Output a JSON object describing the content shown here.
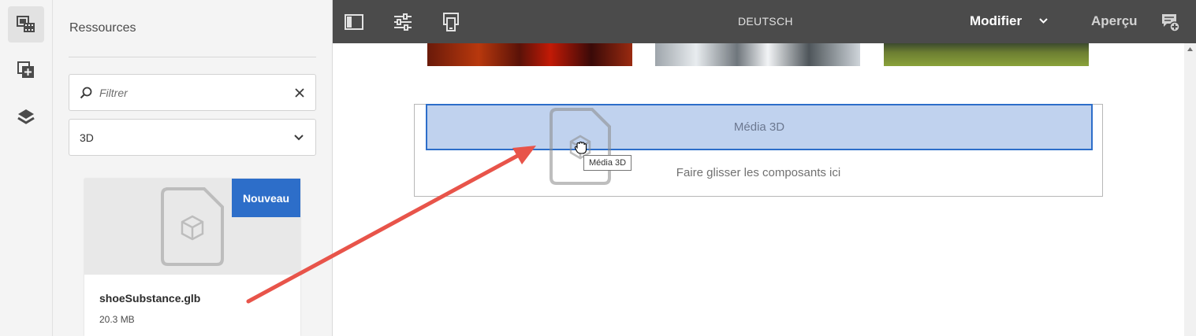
{
  "rail": {
    "items": [
      {
        "name": "assets",
        "icon": "assets-icon",
        "active": true
      },
      {
        "name": "components",
        "icon": "add-component-icon",
        "active": false
      },
      {
        "name": "content-tree",
        "icon": "layers-icon",
        "active": false
      }
    ]
  },
  "panel": {
    "title": "Ressources",
    "search": {
      "placeholder": "Filtrer",
      "value": ""
    },
    "filter": {
      "selected": "3D"
    },
    "asset": {
      "badge": "Nouveau",
      "name": "shoeSubstance.glb",
      "size": "20.3 MB",
      "icon": "3d-file-icon"
    }
  },
  "toolbar": {
    "language": "DEUTSCH",
    "mode": "Modifier",
    "preview": "Aperçu",
    "icons": [
      "toggle-side-panel-icon",
      "page-properties-icon",
      "emulator-icon",
      "annotations-icon"
    ]
  },
  "canvas": {
    "dropzone": {
      "highlight_label": "Média 3D",
      "placeholder": "Faire glisser les composants ici"
    },
    "drag": {
      "tooltip": "Média 3D"
    }
  },
  "colors": {
    "accent": "#2d6ec9",
    "toolbar_bg": "#4b4b4b",
    "highlight": "#c0d2ee",
    "arrow": "#e8544a"
  }
}
